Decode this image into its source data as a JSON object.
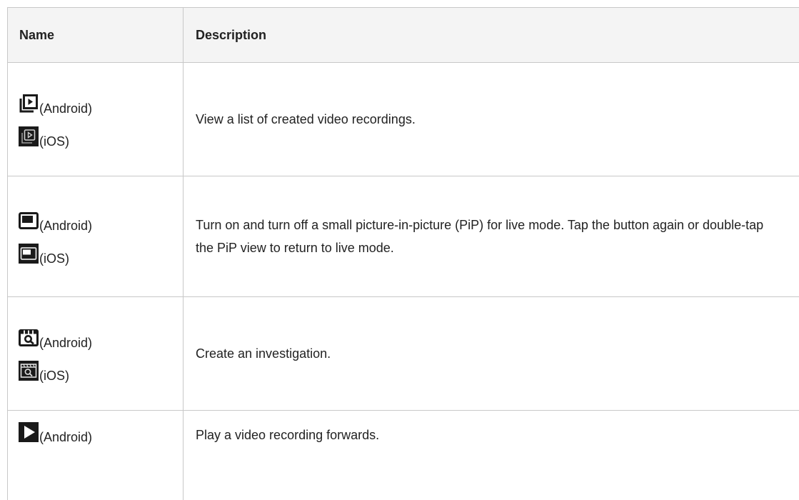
{
  "table": {
    "headers": {
      "name": "Name",
      "description": "Description"
    },
    "rows": [
      {
        "android_icon": "recordings-list-icon",
        "android_label": "(Android)",
        "ios_icon": "recordings-list-icon",
        "ios_label": "(iOS)",
        "description": "View a list of created video recordings."
      },
      {
        "android_icon": "picture-in-picture-icon",
        "android_label": "(Android)",
        "ios_icon": "picture-in-picture-icon",
        "ios_label": "(iOS)",
        "description": "Turn on and turn off a small picture-in-picture (PiP) for live mode. Tap the button again or double-tap the PiP view to return to live mode."
      },
      {
        "android_icon": "investigation-icon",
        "android_label": "(Android)",
        "ios_icon": "investigation-icon",
        "ios_label": "(iOS)",
        "description": "Create an investigation."
      },
      {
        "android_icon": "play-forward-icon",
        "android_label": "(Android)",
        "description": "Play a video recording forwards."
      }
    ]
  },
  "colors": {
    "border": "#c8c8c8",
    "header_bg": "#f4f4f4",
    "text": "#222222",
    "icon_dark": "#1a1a1a"
  }
}
